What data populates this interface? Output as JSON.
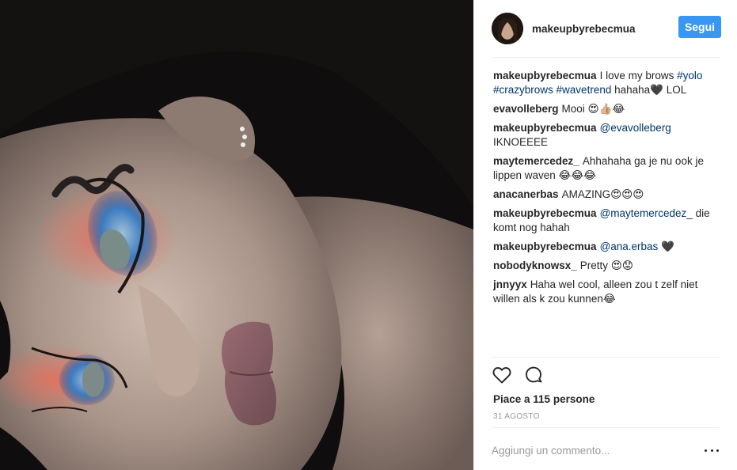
{
  "post": {
    "username": "makeupbyrebecmua",
    "follow_label": "Segui"
  },
  "comments": [
    {
      "user": "makeupbyrebecmua",
      "parts": [
        {
          "text": "I love my brows "
        },
        {
          "text": "#yolo",
          "tag": true
        },
        {
          "text": " "
        },
        {
          "text": "#crazybrows",
          "tag": true
        },
        {
          "text": " "
        },
        {
          "text": "#wavetrend",
          "tag": true
        },
        {
          "text": " hahaha🖤 LOL"
        }
      ]
    },
    {
      "user": "evavolleberg",
      "parts": [
        {
          "text": "Mooi 😍👍🏼😂"
        }
      ]
    },
    {
      "user": "makeupbyrebecmua",
      "parts": [
        {
          "text": "@evavolleberg",
          "tag": true
        },
        {
          "text": " IKNOEEEE"
        }
      ]
    },
    {
      "user": "maytemercedez_",
      "parts": [
        {
          "text": "Ahhahaha ga je nu ook je lippen waven 😂😂😂"
        }
      ]
    },
    {
      "user": "anacanerbas",
      "parts": [
        {
          "text": "AMAZING😍😍😍"
        }
      ]
    },
    {
      "user": "makeupbyrebecmua",
      "parts": [
        {
          "text": "@maytemercedez_",
          "tag": true
        },
        {
          "text": " die komt nog hahah"
        }
      ]
    },
    {
      "user": "makeupbyrebecmua",
      "parts": [
        {
          "text": "@ana.erbas",
          "tag": true
        },
        {
          "text": " 🖤"
        }
      ]
    },
    {
      "user": "nobodyknowsx_",
      "parts": [
        {
          "text": "Pretty 😍😟"
        }
      ]
    },
    {
      "user": "jnnyyx",
      "parts": [
        {
          "text": "Haha wel cool, alleen zou t zelf niet willen als k zou kunnen😂"
        }
      ]
    }
  ],
  "actions": {
    "like_icon": "heart-outline-icon",
    "comment_icon": "speech-bubble-icon",
    "more_icon": "ellipsis-icon"
  },
  "likes_text": "Piace a 115 persone",
  "date_text": "31 agosto",
  "comment_input": {
    "placeholder": "Aggiungi un commento...",
    "value": ""
  },
  "colors": {
    "follow_button": "#3897f0",
    "hashtag": "#003569",
    "border": "#efefef",
    "muted": "#999999"
  }
}
